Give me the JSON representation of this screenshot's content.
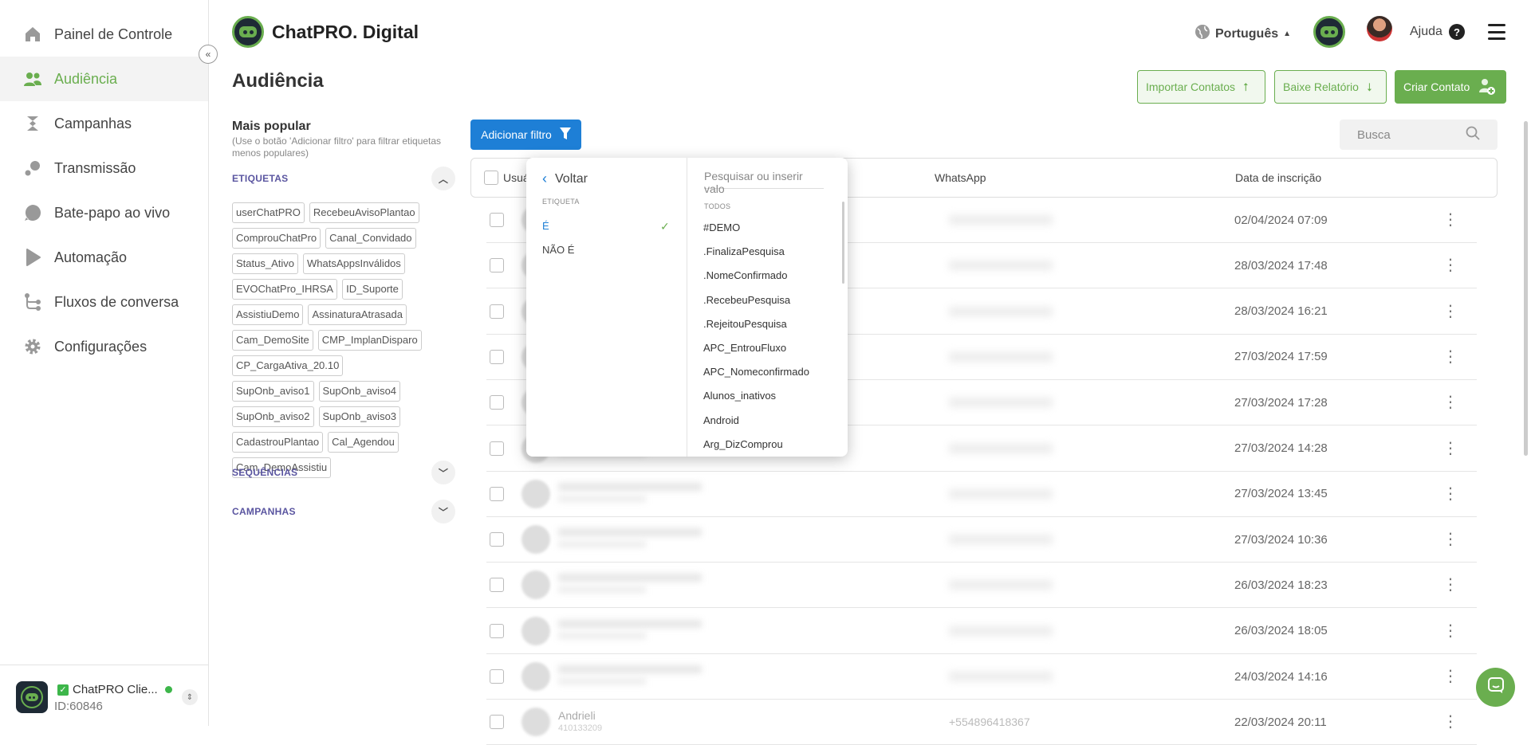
{
  "nav": {
    "items": [
      {
        "label": "Painel de Controle",
        "icon": "home-icon"
      },
      {
        "label": "Audiência",
        "icon": "users-icon"
      },
      {
        "label": "Campanhas",
        "icon": "campaign-icon"
      },
      {
        "label": "Transmissão",
        "icon": "broadcast-icon"
      },
      {
        "label": "Bate-papo ao vivo",
        "icon": "chat-icon"
      },
      {
        "label": "Automação",
        "icon": "automation-icon"
      },
      {
        "label": "Fluxos de conversa",
        "icon": "flow-icon"
      },
      {
        "label": "Configurações",
        "icon": "gear-icon"
      }
    ],
    "active_index": 1
  },
  "account": {
    "name": "ChatPRO Clie...",
    "id": "ID:60846"
  },
  "header": {
    "brand": "ChatPRO. Digital",
    "language": "Português",
    "help": "Ajuda"
  },
  "page": {
    "title": "Audiência",
    "actions": {
      "import": "Importar Contatos",
      "report": "Baixe Relatório",
      "create": "Criar Contato"
    }
  },
  "filters": {
    "heading": "Mais popular",
    "hint": "(Use o botão 'Adicionar filtro' para filtrar etiquetas menos populares)",
    "sections": {
      "tags": "ETIQUETAS",
      "sequences": "SEQUÊNCIAS",
      "campaigns": "CAMPANHAS"
    },
    "tags": [
      "userChatPRO",
      "RecebeuAvisoPlantao",
      "ComprouChatPro",
      "Canal_Convidado",
      "Status_Ativo",
      "WhatsAppsInválidos",
      "EVOChatPro_IHRSA",
      "ID_Suporte",
      "AssistiuDemo",
      "AssinaturaAtrasada",
      "Cam_DemoSite",
      "CMP_ImplanDisparo",
      "CP_CargaAtiva_20.10",
      "SupOnb_aviso1",
      "SupOnb_aviso4",
      "SupOnb_aviso2",
      "SupOnb_aviso3",
      "CadastrouPlantao",
      "Cal_Agendou",
      "Cam_DemoAssistiu"
    ]
  },
  "toolbar": {
    "add_filter": "Adicionar filtro",
    "search_placeholder": "Busca"
  },
  "table": {
    "columns": {
      "user": "Usuá",
      "whatsapp": "WhatsApp",
      "date": "Data de inscrição"
    },
    "rows": [
      {
        "date": "02/04/2024 07:09"
      },
      {
        "date": "28/03/2024 17:48"
      },
      {
        "date": "28/03/2024 16:21"
      },
      {
        "date": "27/03/2024 17:59"
      },
      {
        "date": "27/03/2024 17:28"
      },
      {
        "date": "27/03/2024 14:28"
      },
      {
        "date": "27/03/2024 13:45"
      },
      {
        "date": "27/03/2024 10:36"
      },
      {
        "date": "26/03/2024 18:23"
      },
      {
        "date": "26/03/2024 18:05"
      },
      {
        "date": "24/03/2024 14:16"
      },
      {
        "date": "22/03/2024 20:11",
        "name": "Andrieli",
        "sub": "410133209",
        "phone": "+554896418367"
      }
    ]
  },
  "dropdown": {
    "back": "Voltar",
    "operator_label": "ETIQUETA",
    "operators": [
      "É",
      "NÃO É"
    ],
    "selected_operator": "É",
    "search_placeholder": "Pesquisar ou inserir valo",
    "values_label": "TODOS",
    "values": [
      "#DEMO",
      ".FinalizaPesquisa",
      ".NomeConfirmado",
      ".RecebeuPesquisa",
      ".RejeitouPesquisa",
      "APC_EntrouFluxo",
      "APC_Nomeconfirmado",
      "Alunos_inativos",
      "Android",
      "Arg_DizComprou"
    ]
  },
  "colors": {
    "accent": "#6aae4f",
    "primary": "#1e7fd6",
    "section": "#5a55a0"
  }
}
